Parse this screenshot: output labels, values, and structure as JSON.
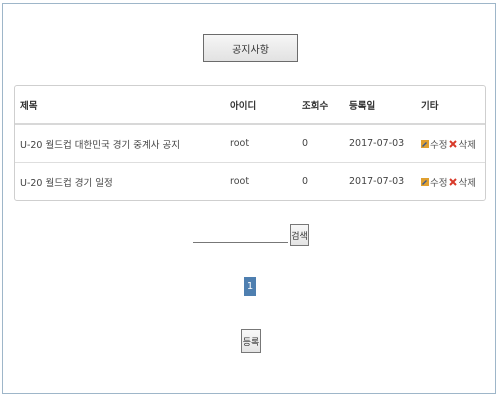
{
  "header": {
    "title_button": "공지사항"
  },
  "table": {
    "columns": [
      "제목",
      "아이디",
      "조회수",
      "등록일",
      "기타"
    ],
    "rows": [
      {
        "title": "U-20 월드컵 대한민국 경기 중계사 공지",
        "id": "root",
        "views": "0",
        "date": "2017-07-03",
        "edit": "수정",
        "delete": "삭제"
      },
      {
        "title": "U-20 월드컵 경기 일정",
        "id": "root",
        "views": "0",
        "date": "2017-07-03",
        "edit": "수정",
        "delete": "삭제"
      }
    ]
  },
  "search": {
    "value": "",
    "button": "검색"
  },
  "pagination": {
    "current": "1"
  },
  "footer": {
    "register_button": "등록"
  },
  "colors": {
    "page_active": "#4e7fb0",
    "delete_icon": "#d83a2a",
    "edit_icon": "#e0a030",
    "frame_border": "#9eb6c9"
  },
  "icons": {
    "edit": "pencil-icon",
    "delete": "x-icon"
  }
}
